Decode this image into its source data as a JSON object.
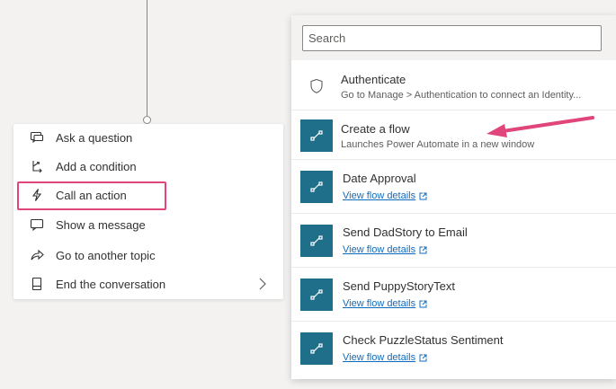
{
  "node_menu": {
    "items": [
      {
        "label": "Ask a question",
        "icon": "chat-question-icon"
      },
      {
        "label": "Add a condition",
        "icon": "branch-icon"
      },
      {
        "label": "Call an action",
        "icon": "lightning-icon"
      },
      {
        "label": "Show a message",
        "icon": "message-icon"
      },
      {
        "label": "Go to another topic",
        "icon": "redirect-arrow-icon"
      },
      {
        "label": "End the conversation",
        "icon": "end-icon",
        "has_submenu": true
      }
    ]
  },
  "action_panel": {
    "search": {
      "placeholder": "Search",
      "value": ""
    },
    "items": [
      {
        "title": "Authenticate",
        "subtitle": "Go to Manage > Authentication to connect an Identity...",
        "icon": "shield-icon"
      },
      {
        "title": "Create a flow",
        "subtitle": "Launches Power Automate in a new window",
        "icon": "flow-icon"
      },
      {
        "title": "Date Approval",
        "link": "View flow details",
        "icon": "flow-icon"
      },
      {
        "title": "Send DadStory to Email",
        "link": "View flow details",
        "icon": "flow-icon"
      },
      {
        "title": "Send PuppyStoryText",
        "link": "View flow details",
        "icon": "flow-icon"
      },
      {
        "title": "Check PuzzleStatus Sentiment",
        "link": "View flow details",
        "icon": "flow-icon"
      }
    ]
  },
  "colors": {
    "highlight": "#e0457b",
    "tile": "#1f6f8b",
    "link": "#0f6cbd",
    "canvas": "#f3f2f1"
  }
}
